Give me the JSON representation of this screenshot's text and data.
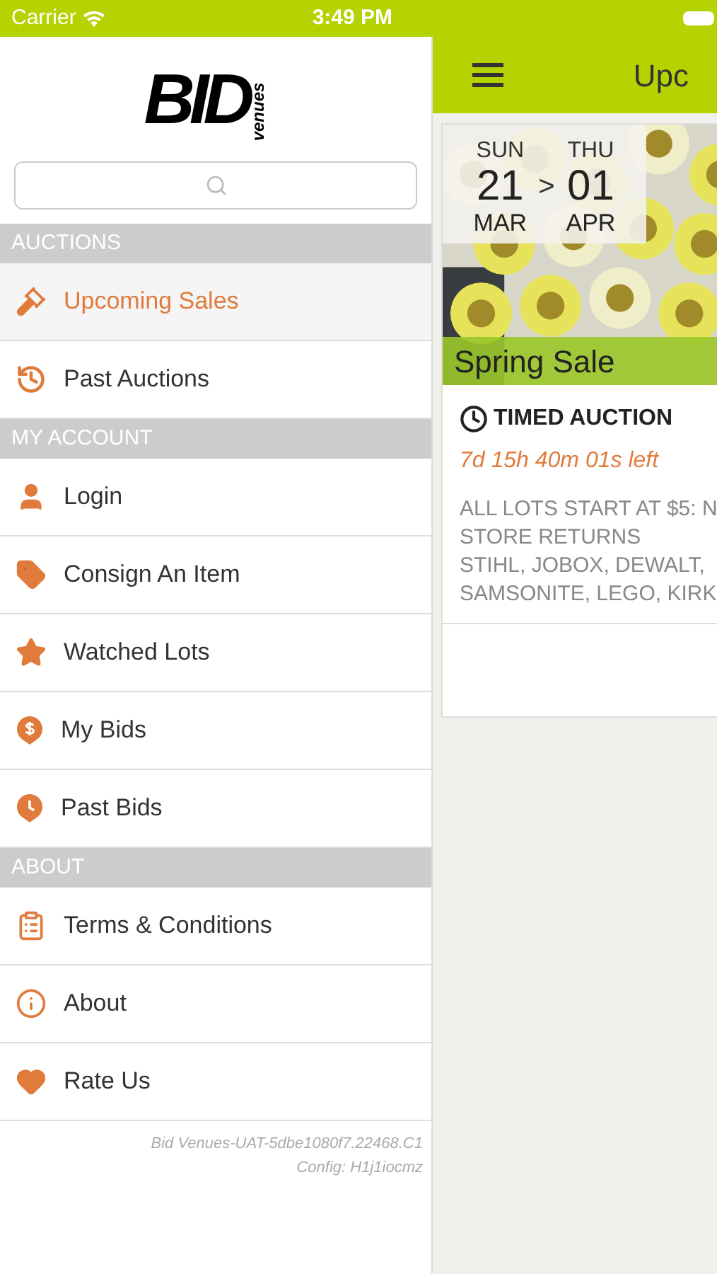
{
  "status_bar": {
    "carrier": "Carrier",
    "time": "3:49 PM"
  },
  "drawer": {
    "logo": {
      "wordmark": "BID",
      "tagline": "venues"
    },
    "sections": [
      {
        "title": "AUCTIONS",
        "items": [
          {
            "label": "Upcoming Sales",
            "kind": "gavel",
            "selected": true
          },
          {
            "label": "Past Auctions",
            "kind": "history",
            "selected": false
          }
        ]
      },
      {
        "title": "MY ACCOUNT",
        "items": [
          {
            "label": "Login",
            "kind": "user",
            "selected": false
          },
          {
            "label": "Consign An Item",
            "kind": "tag",
            "selected": false
          },
          {
            "label": "Watched Lots",
            "kind": "star",
            "selected": false
          },
          {
            "label": "My Bids",
            "kind": "dollar-pin",
            "selected": false
          },
          {
            "label": "Past Bids",
            "kind": "clock-pin",
            "selected": false
          }
        ]
      },
      {
        "title": "ABOUT",
        "items": [
          {
            "label": "Terms & Conditions",
            "kind": "clipboard",
            "selected": false
          },
          {
            "label": "About",
            "kind": "info",
            "selected": false
          },
          {
            "label": "Rate Us",
            "kind": "heart",
            "selected": false
          }
        ]
      }
    ],
    "footer": [
      "Bid Venues-UAT-5dbe1080f7.22468.C1",
      "Config: H1j1iocmz"
    ]
  },
  "main": {
    "title": "Upc",
    "card": {
      "start": {
        "weekday": "SUN",
        "day": "21",
        "month": "MAR"
      },
      "separator": ">",
      "end": {
        "weekday": "THU",
        "day": "01",
        "month": "APR"
      },
      "name": "Spring Sale",
      "type": "TIMED AUCTION",
      "countdown": "7d 15h 40m 01s left",
      "description": [
        "ALL LOTS START AT $5: N",
        "STORE RETURNS",
        "STIHL, JOBOX, DEWALT,",
        "SAMSONITE, LEGO, KIRK"
      ]
    }
  }
}
